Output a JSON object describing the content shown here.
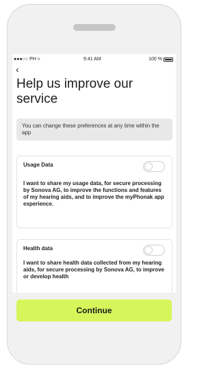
{
  "status_bar": {
    "carrier": "●●●○○ PH",
    "wifi_glyph": "≈",
    "time": "9:41 AM",
    "battery": "100 %"
  },
  "nav": {
    "back_glyph": "‹"
  },
  "page": {
    "title": "Help us improve our service"
  },
  "info_banner": {
    "text": "You can change these preferences at any time within the app"
  },
  "usage_data": {
    "title": "Usage Data",
    "description": "I want to share my usage data, for secure processing by Sonova AG, to improve the functions and features of my hearing aids, and to improve the myPhonak app experience.",
    "enabled": false
  },
  "health_data": {
    "title": "Health data",
    "description": "I want to share health data collected from my hearing aids, for secure processing by Sonova AG, to improve or develop health",
    "enabled": false
  },
  "footer": {
    "continue_label": "Continue"
  },
  "colors": {
    "accent": "#d6f55a",
    "frame": "#f1f1f1",
    "banner": "#e8e8e8"
  }
}
